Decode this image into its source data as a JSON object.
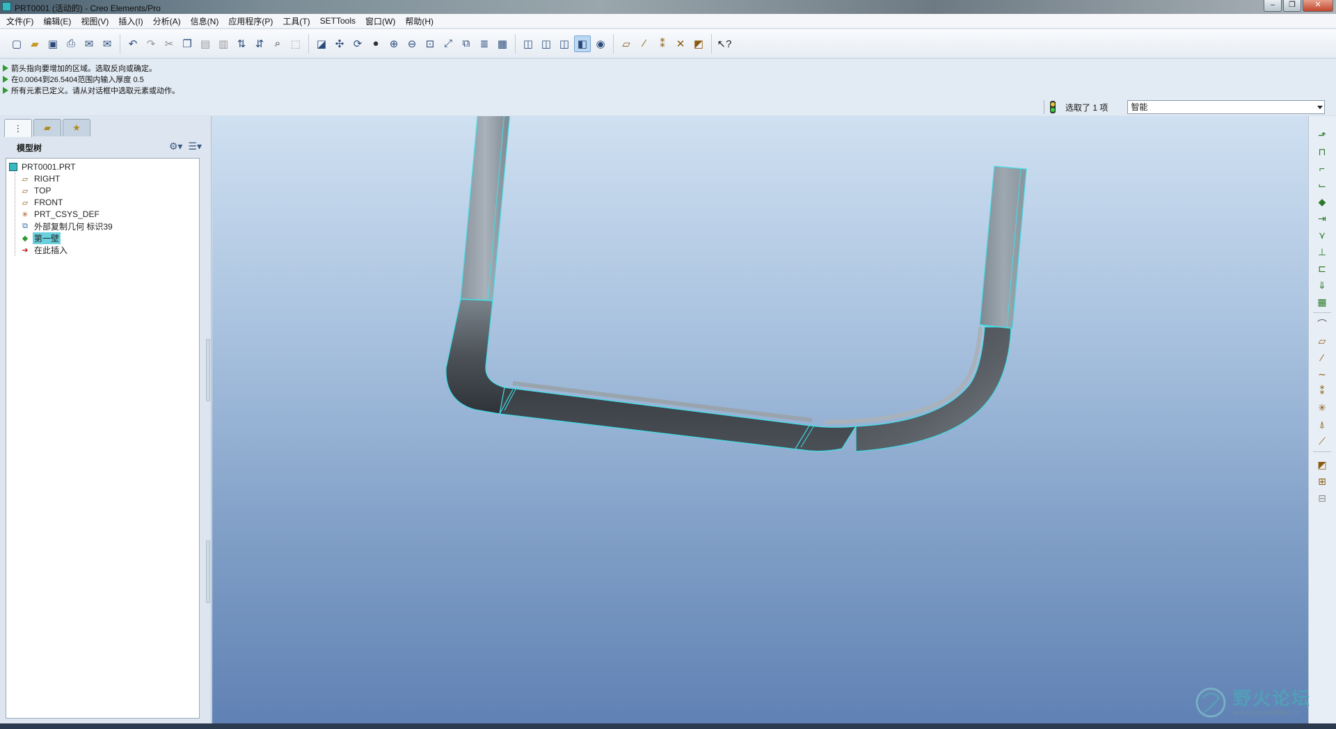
{
  "window": {
    "title": "PRT0001 (活动的) - Creo Elements/Pro",
    "minimize": "–",
    "restore": "❐",
    "close": "✕"
  },
  "menubar": {
    "items": [
      "文件(F)",
      "编辑(E)",
      "视图(V)",
      "插入(I)",
      "分析(A)",
      "信息(N)",
      "应用程序(P)",
      "工具(T)",
      "SETTools",
      "窗口(W)",
      "帮助(H)"
    ]
  },
  "messages": [
    "箭头指向要增加的区域。选取反向或确定。",
    "在0.0064到26.5404范围内输入厚度  0.5",
    "所有元素已定义。请从对话框中选取元素或动作。"
  ],
  "selection": {
    "status": "选取了 1 项",
    "filter": "智能"
  },
  "navigator": {
    "title": "模型树",
    "tree": [
      {
        "label": "PRT0001.PRT",
        "icon": "part-icon"
      },
      {
        "label": "RIGHT",
        "icon": "datum-plane-icon"
      },
      {
        "label": "TOP",
        "icon": "datum-plane-icon"
      },
      {
        "label": "FRONT",
        "icon": "datum-plane-icon"
      },
      {
        "label": "PRT_CSYS_DEF",
        "icon": "csys-icon"
      },
      {
        "label": "外部复制几何 标识39",
        "icon": "copy-geom-icon"
      },
      {
        "label": "第一壁",
        "icon": "sheetmetal-wall-icon",
        "selected": true
      },
      {
        "label": "在此插入",
        "icon": "insert-here-icon"
      }
    ]
  },
  "watermark": {
    "title": "野火论坛",
    "url": "www.proewildfire.cn"
  },
  "colors": {
    "edge_highlight": "#3fe0e8",
    "wall_light": "#9aa4ad",
    "wall_dark": "#3a3f44",
    "selection_bg": "#6bd0de"
  }
}
